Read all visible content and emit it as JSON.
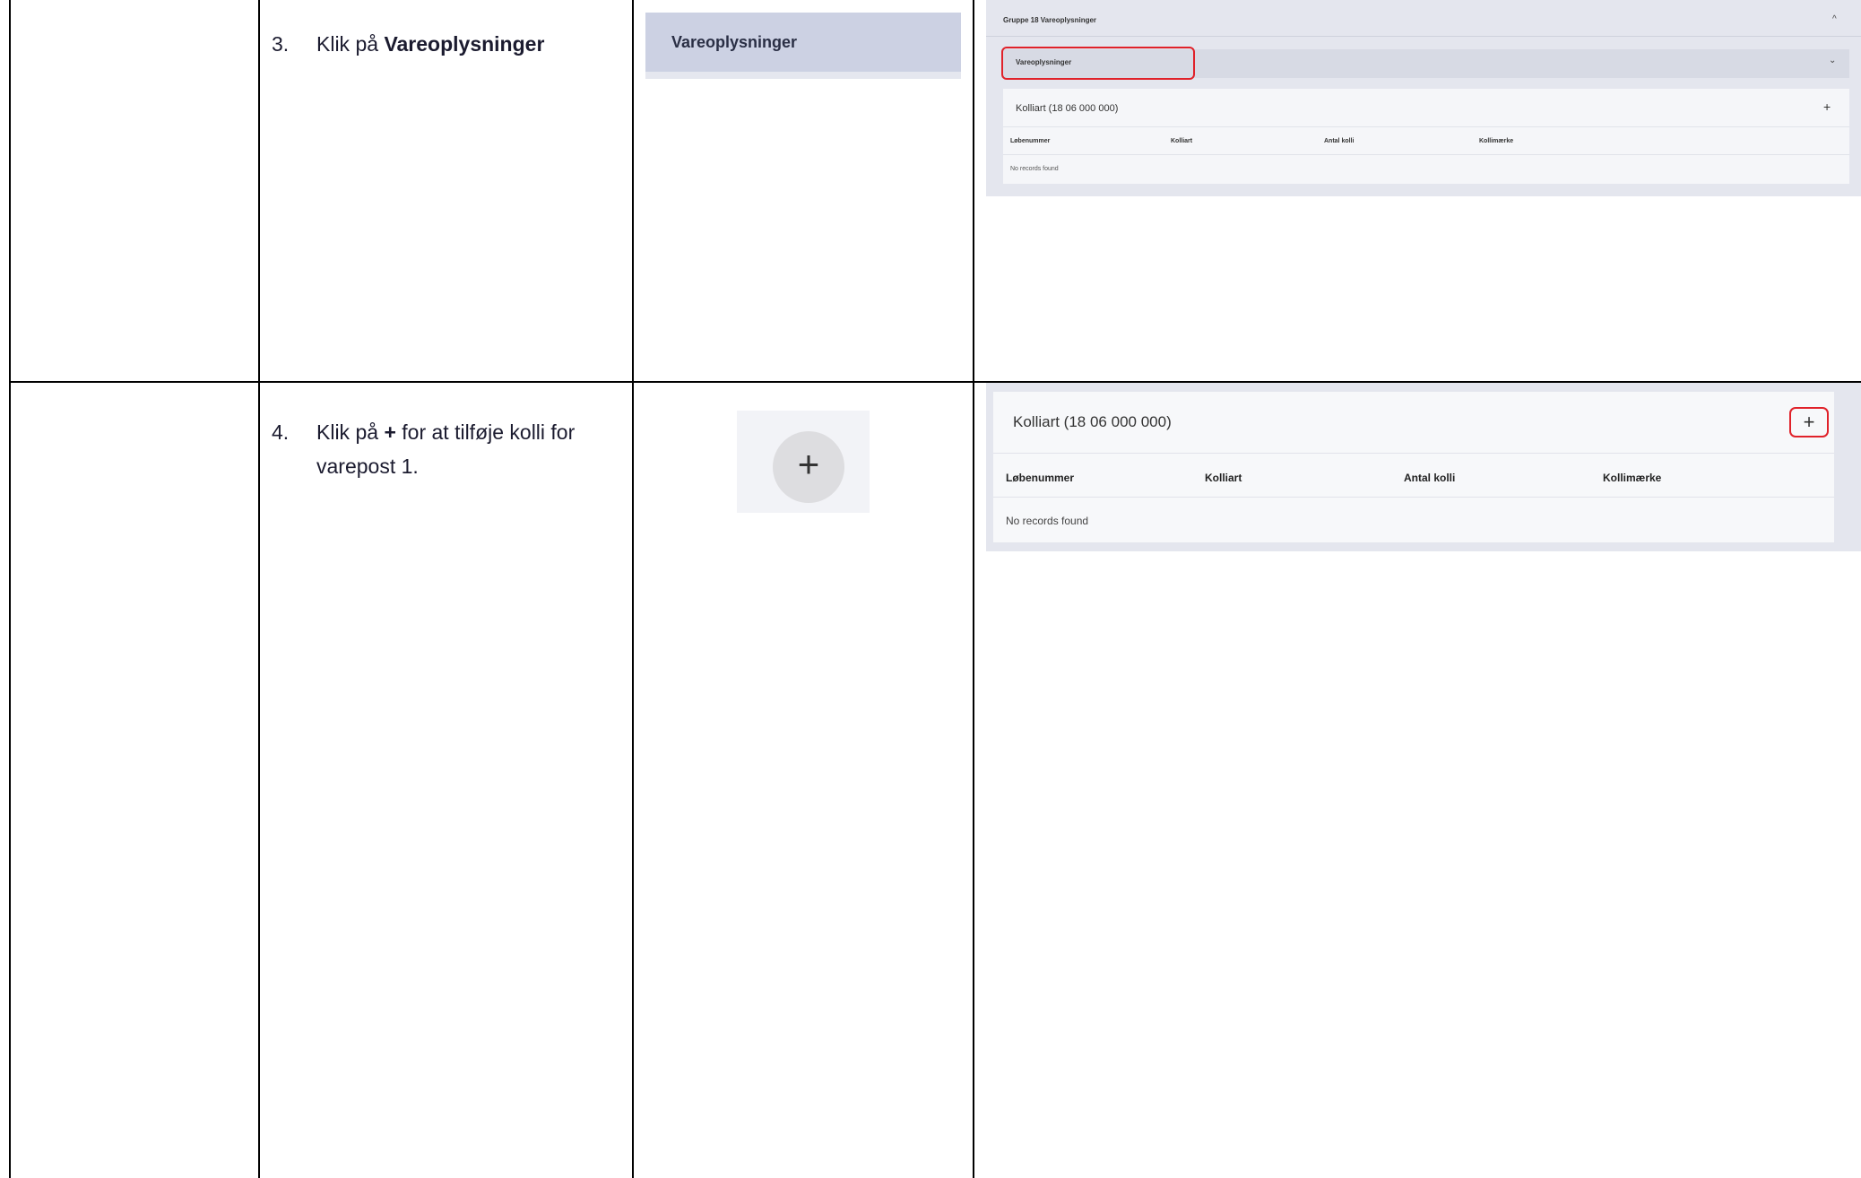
{
  "rows": [
    {
      "step_number": "3.",
      "instruction_prefix": "Klik på ",
      "instruction_bold": "Vareoplysninger",
      "button_label": "Vareoplysninger",
      "screenshot": {
        "group_title": "Gruppe 18 Vareoplysninger",
        "group_caret": "^",
        "section_title": "Vareoplysninger",
        "section_caret": "⌄",
        "card_title": "Kolliart (18 06 000 000)",
        "add_icon": "plus-icon",
        "columns": [
          "Løbenummer",
          "Kolliart",
          "Antal kolli",
          "Kollimærke"
        ],
        "empty_text": "No records found",
        "highlight_color": "#e0222a"
      }
    },
    {
      "step_number": "4.",
      "instruction_prefix": "Klik på ",
      "instruction_bold": "+",
      "instruction_suffix": " for at tilføje kolli for varepost 1.",
      "button_symbol": "+",
      "screenshot": {
        "card_title": "Kolliart (18 06 000 000)",
        "add_symbol": "+",
        "columns": [
          "Løbenummer",
          "Kolliart",
          "Antal kolli",
          "Kollimærke"
        ],
        "empty_text": "No records found",
        "highlight_color": "#e0222a"
      }
    }
  ]
}
